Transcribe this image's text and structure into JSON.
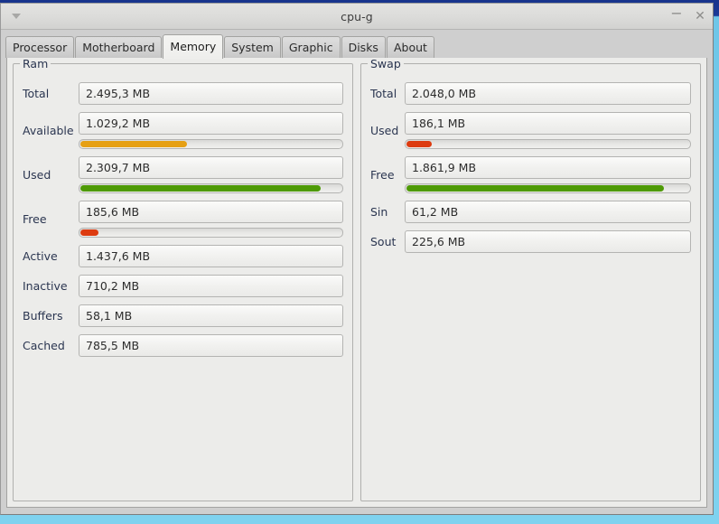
{
  "window": {
    "title": "cpu-g",
    "menu_icon": "caret-down-icon",
    "minimize_label": "−",
    "close_label": "✕"
  },
  "tabs": [
    {
      "label": "Processor",
      "active": false
    },
    {
      "label": "Motherboard",
      "active": false
    },
    {
      "label": "Memory",
      "active": true
    },
    {
      "label": "System",
      "active": false
    },
    {
      "label": "Graphic",
      "active": false
    },
    {
      "label": "Disks",
      "active": false
    },
    {
      "label": "About",
      "active": false
    }
  ],
  "ram": {
    "legend": "Ram",
    "rows": [
      {
        "label": "Total",
        "value": "2.495,3 MB",
        "bar": null
      },
      {
        "label": "Available",
        "value": "1.029,2 MB",
        "bar": {
          "percent": 41,
          "color": "#e6a014"
        }
      },
      {
        "label": "Used",
        "value": "2.309,7 MB",
        "bar": {
          "percent": 92,
          "color": "#4e9a06"
        }
      },
      {
        "label": "Free",
        "value": "185,6 MB",
        "bar": {
          "percent": 7,
          "color": "#dd3b10"
        }
      },
      {
        "label": "Active",
        "value": "1.437,6 MB",
        "bar": null
      },
      {
        "label": "Inactive",
        "value": "710,2 MB",
        "bar": null
      },
      {
        "label": "Buffers",
        "value": "58,1 MB",
        "bar": null
      },
      {
        "label": "Cached",
        "value": "785,5 MB",
        "bar": null
      }
    ]
  },
  "swap": {
    "legend": "Swap",
    "rows": [
      {
        "label": "Total",
        "value": "2.048,0 MB",
        "bar": null
      },
      {
        "label": "Used",
        "value": "186,1 MB",
        "bar": {
          "percent": 9,
          "color": "#dd3b10"
        }
      },
      {
        "label": "Free",
        "value": "1.861,9 MB",
        "bar": {
          "percent": 91,
          "color": "#4e9a06"
        }
      },
      {
        "label": "Sin",
        "value": "61,2 MB",
        "bar": null
      },
      {
        "label": "Sout",
        "value": "225,6 MB",
        "bar": null
      }
    ]
  },
  "colors": {
    "accent_green": "#4e9a06",
    "accent_orange": "#e6a014",
    "accent_red": "#dd3b10",
    "label_text": "#2a3550",
    "desktop": "#6ec6e8"
  }
}
